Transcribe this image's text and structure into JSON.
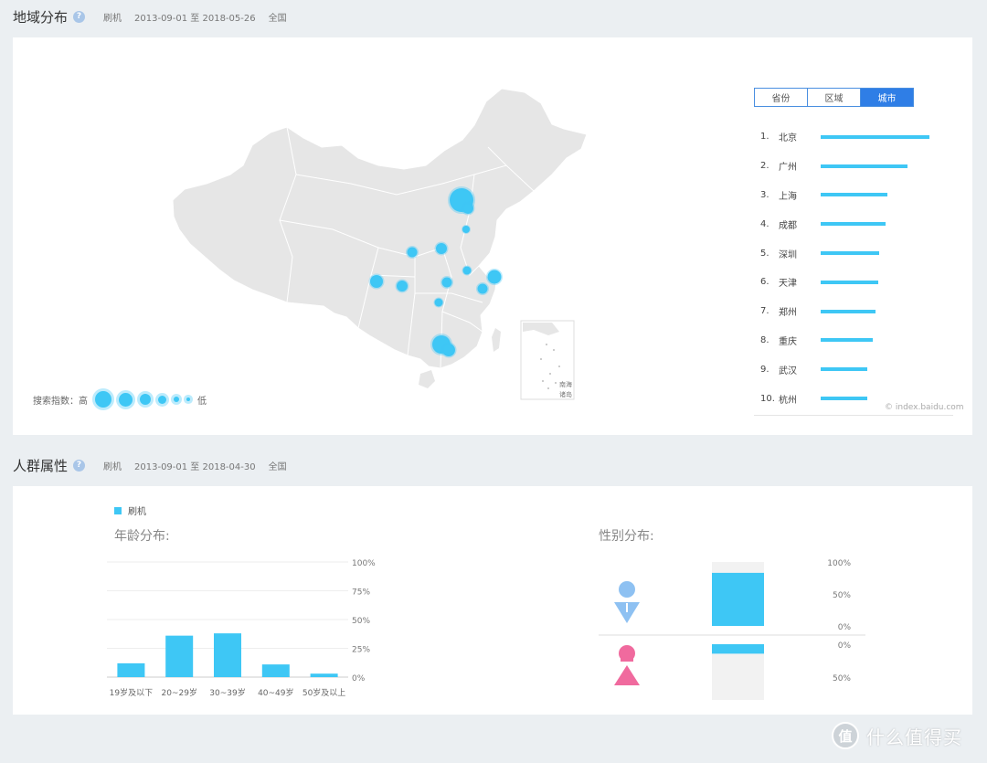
{
  "region_section": {
    "title": "地域分布",
    "help_icon": "question-icon",
    "keyword": "刷机",
    "date_range": "2013-09-01 至 2018-05-26",
    "scope": "全国",
    "legend": {
      "label": "搜索指数：高",
      "low": "低"
    },
    "tabs": [
      {
        "label": "省份",
        "active": false
      },
      {
        "label": "区域",
        "active": false
      },
      {
        "label": "城市",
        "active": true
      }
    ],
    "ranking": [
      {
        "rank": "1.",
        "city": "北京",
        "value": 100
      },
      {
        "rank": "2.",
        "city": "广州",
        "value": 80
      },
      {
        "rank": "3.",
        "city": "上海",
        "value": 61
      },
      {
        "rank": "4.",
        "city": "成都",
        "value": 60
      },
      {
        "rank": "5.",
        "city": "深圳",
        "value": 54
      },
      {
        "rank": "6.",
        "city": "天津",
        "value": 53
      },
      {
        "rank": "7.",
        "city": "郑州",
        "value": 50
      },
      {
        "rank": "8.",
        "city": "重庆",
        "value": 48
      },
      {
        "rank": "9.",
        "city": "武汉",
        "value": 43
      },
      {
        "rank": "10.",
        "city": "杭州",
        "value": 43
      }
    ],
    "watermark": "© index.baidu.com",
    "south_sea_label": [
      "南海",
      "诸岛"
    ]
  },
  "crowd_section": {
    "title": "人群属性",
    "help_icon": "question-icon",
    "keyword": "刷机",
    "date_range": "2013-09-01 至 2018-04-30",
    "scope": "全国",
    "legend_series": "刷机",
    "age_title": "年龄分布:",
    "gender_title": "性别分布:"
  },
  "chart_data": [
    {
      "type": "bar",
      "title": "年龄分布:",
      "categories": [
        "19岁及以下",
        "20~29岁",
        "30~39岁",
        "40~49岁",
        "50岁及以上"
      ],
      "series": [
        {
          "name": "刷机",
          "values": [
            12,
            36,
            38,
            11,
            3
          ]
        }
      ],
      "y_ticks": [
        "100%",
        "75%",
        "50%",
        "25%",
        "0%"
      ],
      "ylim": [
        0,
        100
      ],
      "grid": true,
      "color": "#3ec7f5"
    },
    {
      "type": "bar",
      "title": "性别分布:",
      "categories": [
        "男",
        "女"
      ],
      "series": [
        {
          "name": "刷机",
          "values": [
            83,
            17
          ]
        }
      ],
      "y_ticks_top": [
        "100%",
        "50%",
        "0%"
      ],
      "y_ticks_bottom": [
        "0%",
        "50%"
      ],
      "ylim": [
        0,
        100
      ],
      "color": "#3ec7f5",
      "icons": [
        "male-icon",
        "female-icon"
      ]
    }
  ],
  "colors": {
    "accent": "#3ec7f5",
    "tab_active": "#2f7ee6",
    "male": "#8ec1f2",
    "female": "#f06a9e",
    "map": "#e6e6e6"
  },
  "brand": {
    "logo": "值",
    "text": "什么值得买"
  }
}
